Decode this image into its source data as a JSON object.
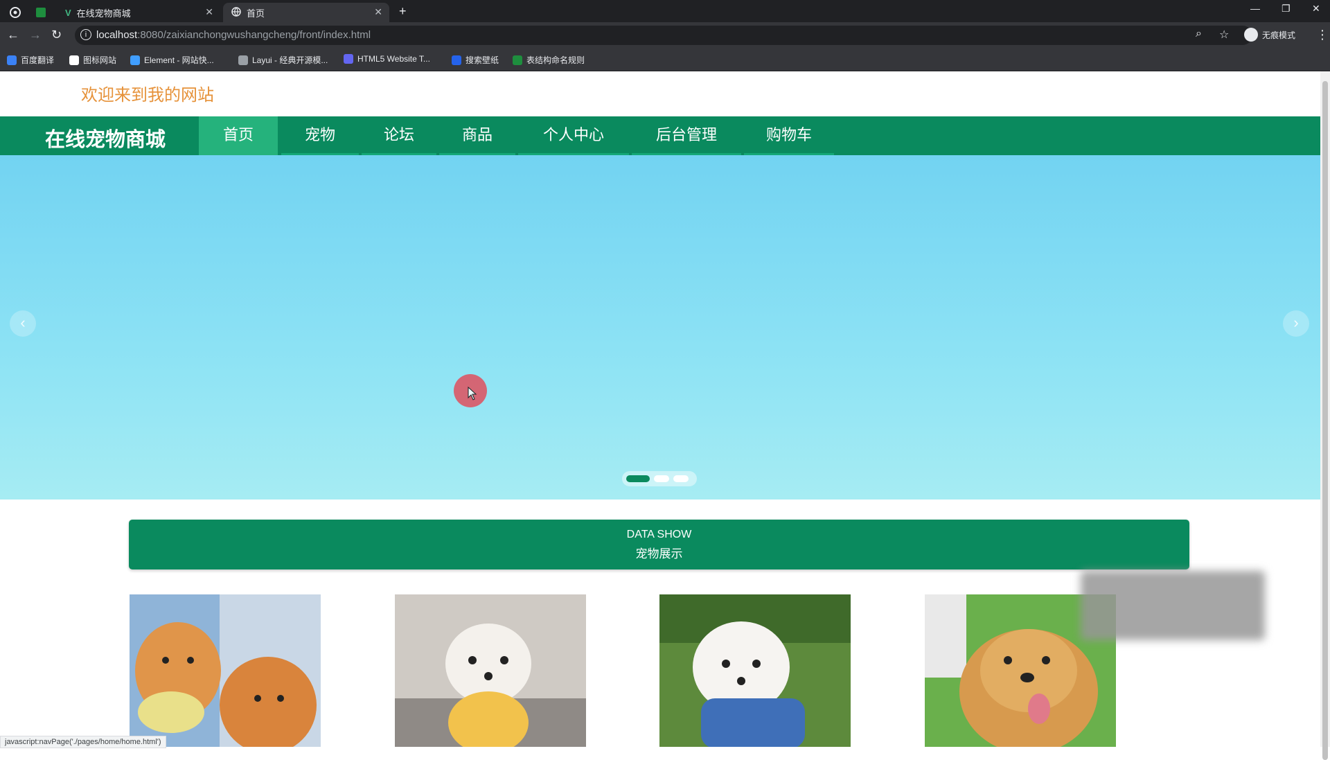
{
  "browser": {
    "tabs": [
      {
        "title": "在线宠物商城",
        "active": false
      },
      {
        "title": "首页",
        "active": true
      }
    ],
    "url_host": "localhost",
    "url_path": ":8080/zaixianchongwushangcheng/front/index.html",
    "profile_label": "无痕模式",
    "bookmarks": [
      "百度翻译",
      "图标网站",
      "Element - 网站快...",
      "Layui - 经典开源模...",
      "HTML5 Website T...",
      "搜索壁纸",
      "表结构命名规则"
    ]
  },
  "header": {
    "welcome": "欢迎来到我的网站"
  },
  "nav": {
    "brand": "在线宠物商城",
    "items": [
      "首页",
      "宠物",
      "论坛",
      "商品",
      "个人中心",
      "后台管理",
      "购物车"
    ],
    "active_index": 0
  },
  "carousel": {
    "prev_icon": "chevron-left-icon",
    "next_icon": "chevron-right-icon",
    "slide_count": 3,
    "active_slide": 0
  },
  "section": {
    "title_en": "DATA SHOW",
    "title_cn": "宠物展示"
  },
  "pets": [
    {
      "image": "pomeranian-photo"
    },
    {
      "image": "white-puppy-photo"
    },
    {
      "image": "bichon-photo"
    },
    {
      "image": "golden-retriever-photo"
    }
  ],
  "status_text": "javascript:navPage('./pages/home/home.html')",
  "colors": {
    "primary": "#0a8a5e",
    "nav_active": "#25b27c",
    "welcome": "#e6923a",
    "banner_top": "#72d3f2",
    "banner_bottom": "#a6ecf3"
  }
}
